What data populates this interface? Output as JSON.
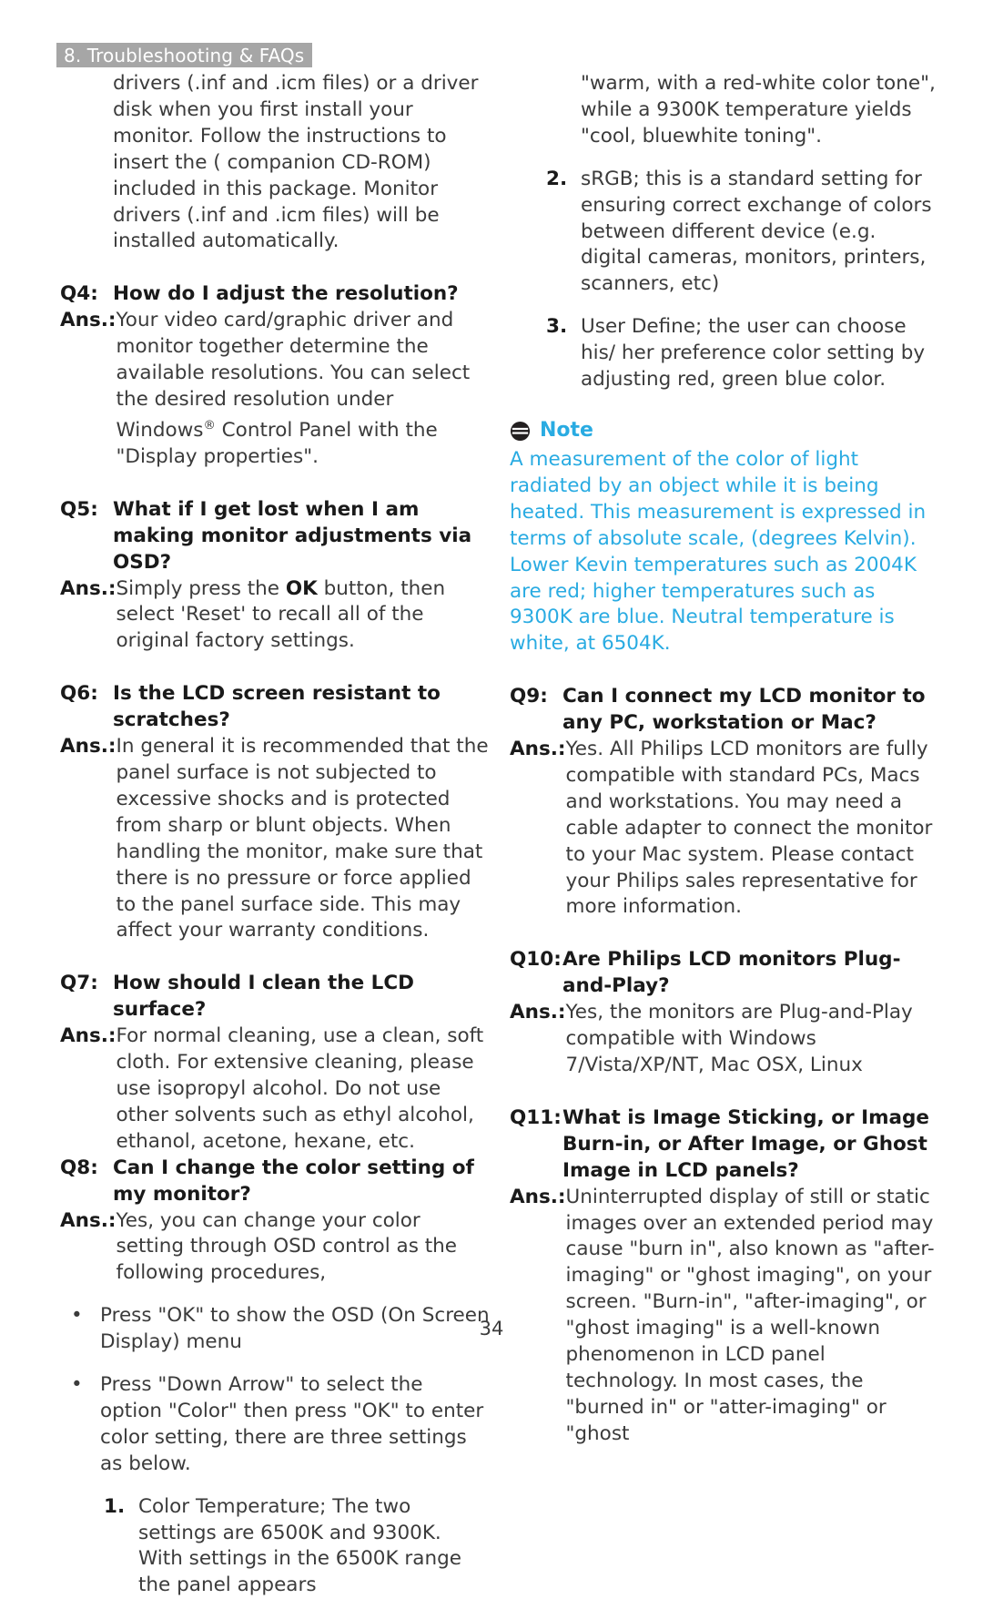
{
  "header": {
    "chapter_label": "8. Troubleshooting & FAQs"
  },
  "footer": {
    "page_number": "34"
  },
  "colors": {
    "header_band": "#a6a6a6",
    "header_text": "#ffffff",
    "body_text": "#3b3b3b",
    "heading_text": "#1a1a1a",
    "note_accent": "#29abe2"
  },
  "icons": {
    "note": "note-icon"
  },
  "left_column": {
    "continuation_paragraph": "drivers (.inf and .icm files) or a driver disk when you first install your monitor. Follow the instructions to insert the ( companion CD-ROM) included in this package. Monitor drivers (.inf and .icm files) will be installed automatically.",
    "faqs": [
      {
        "q_label": "Q4:",
        "question": "How do I adjust the resolution?",
        "a_label": "Ans.:",
        "answer_pre": "Your video card/graphic driver and monitor together determine the available resolutions. You can select the desired resolution under Windows",
        "answer_sup": "®",
        "answer_post": " Control Panel with the \"Display properties\"."
      },
      {
        "q_label": "Q5:",
        "question": "What if I get lost when I am making monitor adjustments via OSD?",
        "a_label": "Ans.:",
        "answer_pre": "Simply press the ",
        "answer_bold": "OK",
        "answer_post": " button, then select 'Reset' to recall all of the original factory settings."
      },
      {
        "q_label": "Q6:",
        "question": "Is the LCD screen resistant to scratches?",
        "a_label": "Ans.:",
        "answer": "In general it is recommended that the panel surface is not subjected to excessive shocks and is protected from sharp or blunt objects. When handling the monitor, make sure that there is no pressure or force applied to the panel surface side. This may affect your warranty conditions."
      },
      {
        "q_label": "Q7:",
        "question": "How should I clean the LCD surface?",
        "a_label": "Ans.:",
        "answer": "For normal cleaning, use a clean, soft cloth. For extensive cleaning, please use isopropyl alcohol. Do not use other solvents such as ethyl alcohol, ethanol, acetone, hexane, etc."
      },
      {
        "q_label": "Q8:",
        "question": "Can I change the color setting of my monitor?",
        "a_label": "Ans.:",
        "answer": "Yes, you can change your color setting through OSD control as the following procedures,"
      }
    ],
    "bullets": [
      {
        "mark": "•",
        "text": "Press \"OK\" to show the OSD (On Screen Display) menu"
      },
      {
        "mark": "•",
        "text": "Press \"Down Arrow\" to select the option \"Color\" then press \"OK\" to enter color setting, there are three settings as below."
      }
    ],
    "numbered_item": {
      "mark": "1.",
      "text": "Color Temperature; The two settings are 6500K and 9300K. With settings in the 6500K range the panel appears"
    }
  },
  "right_column": {
    "continuation_paragraph": "\"warm, with a red-white color tone\", while a 9300K temperature yields \"cool, bluewhite toning\".",
    "numbered_items": [
      {
        "mark": "2.",
        "text": "sRGB; this is a standard setting for ensuring correct exchange of colors between different device (e.g. digital cameras, monitors, printers, scanners, etc)"
      },
      {
        "mark": "3.",
        "text": "User Define; the user can choose his/ her preference color setting by adjusting red, green blue color."
      }
    ],
    "note": {
      "title": "Note",
      "body": "A measurement of the color of light radiated by an object while it is being heated. This measurement is expressed in terms of absolute scale, (degrees Kelvin). Lower Kevin temperatures such as 2004K are red; higher temperatures such as 9300K are blue. Neutral temperature is white, at 6504K."
    },
    "faqs": [
      {
        "q_label": "Q9:",
        "question": "Can I connect my LCD monitor to any PC, workstation or Mac?",
        "a_label": "Ans.:",
        "answer": "Yes. All Philips LCD monitors are fully compatible with standard PCs, Macs and workstations. You may need a cable adapter to connect the monitor to your Mac system. Please contact your Philips sales representative for more information."
      },
      {
        "q_label": "Q10:",
        "question": "Are Philips LCD monitors Plug-and-Play?",
        "a_label": "Ans.:",
        "answer": "Yes, the monitors are Plug-and-Play compatible with Windows 7/Vista/XP/NT, Mac OSX, Linux"
      },
      {
        "q_label": "Q11:",
        "question": "What is Image Sticking, or Image Burn-in, or After Image, or Ghost Image in LCD panels?",
        "a_label": "Ans.:",
        "answer": "Uninterrupted display of still or static images over an extended period may cause \"burn in\", also known as \"after-imaging\" or \"ghost imaging\", on your screen. \"Burn-in\", \"after-imaging\", or \"ghost imaging\" is a well-known phenomenon in LCD panel technology. In most cases, the \"burned in\" or \"atter-imaging\" or \"ghost"
      }
    ]
  }
}
